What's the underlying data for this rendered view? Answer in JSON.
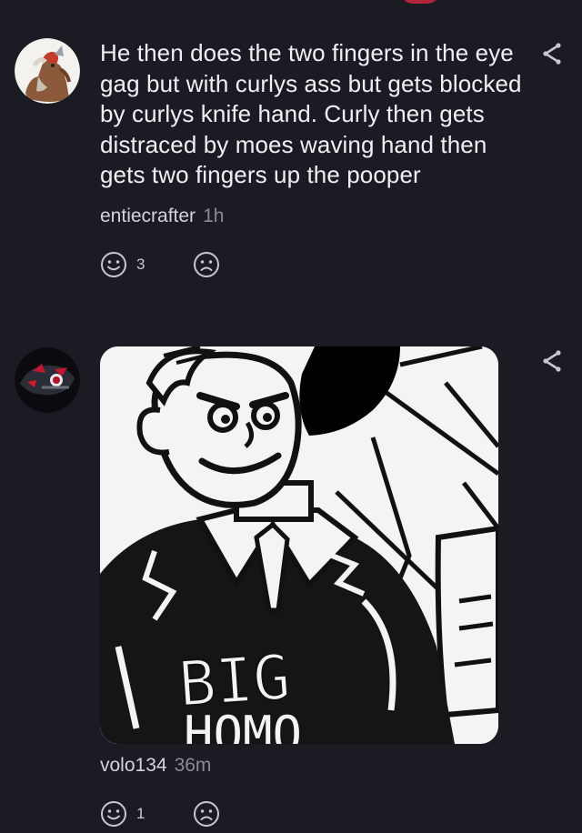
{
  "comments": [
    {
      "text": "He then does the two fingers in the eye gag but with curlys ass but gets blocked by curlys knife hand. Curly then gets distraced by moes waving hand then gets two fingers up the pooper",
      "username": "entiecrafter",
      "time": "1h",
      "like_count": "3",
      "dislike_count": "",
      "avatar_icon": "entei-avatar-icon",
      "share_icon": "share-icon"
    },
    {
      "username": "volo134",
      "time": "36m",
      "like_count": "1",
      "dislike_count": "",
      "avatar_icon": "red-eyed-creature-avatar-icon",
      "share_icon": "share-icon",
      "image": {
        "description_icon": "big-homo-cartoon-image",
        "visible_text": "BIG HOMO"
      }
    }
  ],
  "colors": {
    "background": "#1b1b24",
    "text": "#f0f0f4",
    "username": "#d3d3da",
    "timestamp": "#8a8a94",
    "icon": "#c7c7cf"
  }
}
